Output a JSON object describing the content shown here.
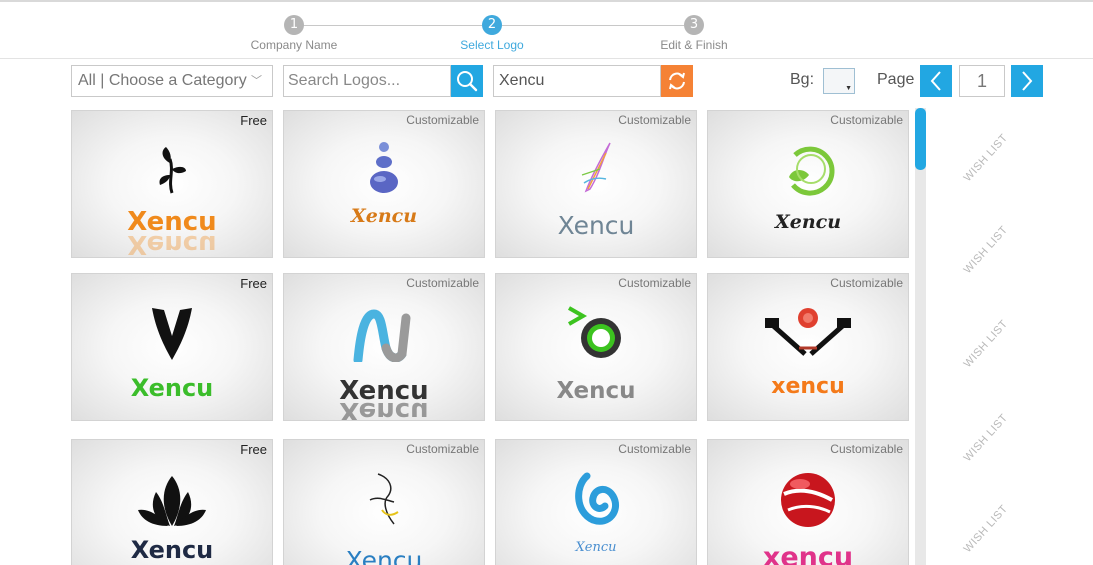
{
  "stepper": {
    "steps": [
      {
        "number": "1",
        "label": "Company Name",
        "state": "done"
      },
      {
        "number": "2",
        "label": "Select Logo",
        "state": "active"
      },
      {
        "number": "3",
        "label": "Edit & Finish",
        "state": "pending"
      }
    ]
  },
  "toolbar": {
    "category": "All | Choose a Category",
    "search_placeholder": "Search Logos...",
    "company_name": "Xencu",
    "bg_label": "Bg:",
    "page_label": "Page",
    "page_number": "1"
  },
  "colors": {
    "accent_blue": "#22a7e2",
    "accent_orange": "#f58235",
    "step_active": "#3fa9dd",
    "step_inactive": "#b5b5b5"
  },
  "logos": [
    {
      "tag": "Free",
      "text": "Xencu",
      "color": "#f08a1c",
      "icon": "sprout-icon"
    },
    {
      "tag": "Customizable",
      "text": "Xencu",
      "color": "#d77a18",
      "icon": "stacked-stones-icon"
    },
    {
      "tag": "Customizable",
      "text": "Xencu",
      "color": "#6f8595",
      "icon": "feather-quill-icon"
    },
    {
      "tag": "Customizable",
      "text": "Xencu",
      "color": "#222222",
      "icon": "green-leaf-circle-icon"
    },
    {
      "tag": "Free",
      "text": "Xencu",
      "color": "#3bbd2b",
      "icon": "v-shield-icon"
    },
    {
      "tag": "Customizable",
      "text": "Xencu",
      "color": "#333333",
      "icon": "ribbon-n-icon"
    },
    {
      "tag": "Customizable",
      "text": "Xencu",
      "color": "#888888",
      "icon": "green-ring-icon"
    },
    {
      "tag": "Customizable",
      "text": "xencu",
      "color": "#f47a1a",
      "icon": "tattoo-machines-rose-icon"
    },
    {
      "tag": "Free",
      "text": "Xencu",
      "color": "#1f2a44",
      "icon": "lotus-flame-icon"
    },
    {
      "tag": "Customizable",
      "text": "Xencu",
      "color": "#2a7fc2",
      "icon": "dancer-figure-icon"
    },
    {
      "tag": "Customizable",
      "text": "Xencu",
      "color": "#4a8fd0",
      "icon": "blue-swirl-icon"
    },
    {
      "tag": "Customizable",
      "text": "xencu",
      "color": "#e0338a",
      "icon": "red-sphere-icon"
    }
  ],
  "wishlist": {
    "label": "WISH LIST"
  }
}
